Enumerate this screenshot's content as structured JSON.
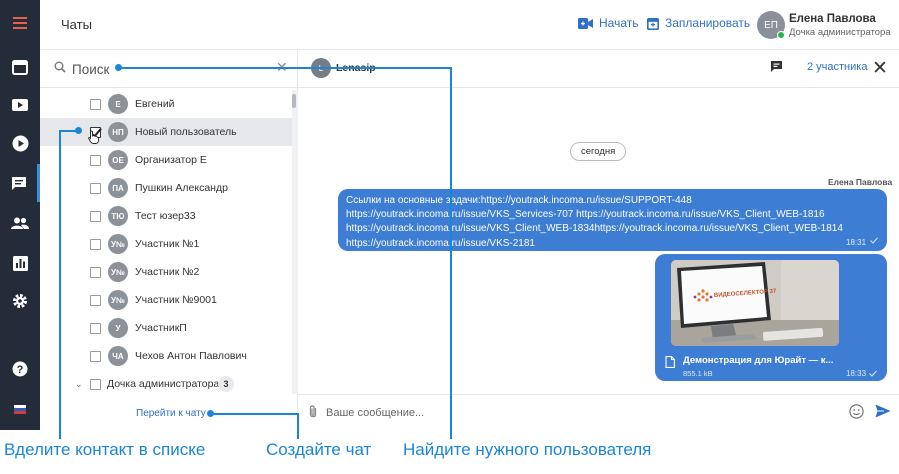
{
  "header": {
    "title": "Чаты",
    "start_label": "Начать",
    "schedule_label": "Запланировать",
    "user": {
      "initials": "ЕП",
      "name": "Елена Павлова",
      "role": "Дочка администратора"
    }
  },
  "sidebar": {
    "items": [
      {
        "icon": "menu-icon"
      },
      {
        "icon": "calendar-icon"
      },
      {
        "icon": "video-camera-icon"
      },
      {
        "icon": "play-icon"
      },
      {
        "icon": "chat-icon",
        "active": true
      },
      {
        "icon": "people-icon"
      },
      {
        "icon": "chart-icon"
      },
      {
        "icon": "gear-icon"
      },
      {
        "icon": "help-icon"
      },
      {
        "icon": "language-flag-icon"
      }
    ]
  },
  "contacts": {
    "search": {
      "placeholder": "Поиск",
      "value": ""
    },
    "items": [
      {
        "initials": "Е",
        "name": "Евгений",
        "checked": false
      },
      {
        "initials": "НП",
        "name": "Новый пользователь",
        "checked": true,
        "selected": true
      },
      {
        "initials": "ОЕ",
        "name": "Организатор Е",
        "checked": false
      },
      {
        "initials": "ПА",
        "name": "Пушкин Александр",
        "checked": false
      },
      {
        "initials": "ТЮ",
        "name": "Тест юзер33",
        "checked": false
      },
      {
        "initials": "У№",
        "name": "Участник №1",
        "checked": false
      },
      {
        "initials": "У№",
        "name": "Участник №2",
        "checked": false
      },
      {
        "initials": "У№",
        "name": "Участник №9001",
        "checked": false
      },
      {
        "initials": "У",
        "name": "УчастникП",
        "checked": false
      },
      {
        "initials": "ЧА",
        "name": "Чехов Антон Павлович",
        "checked": false
      }
    ],
    "group": {
      "name": "Дочка администратора",
      "count": "3"
    },
    "goto_chat_label": "Перейти к чату"
  },
  "chat": {
    "avatar_initial": "L",
    "title": "Lenasip",
    "participants_label": "2 участника",
    "day_label": "сегодня",
    "sender": "Елена Павлова",
    "message": {
      "text": "Ссылки на основные задачи:https://youtrack.incoma.ru/issue/SUPPORT-448 https://youtrack.incoma.ru/issue/VKS_Services-707 https://youtrack.incoma.ru/issue/VKS_Client_WEB-1816 https://youtrack.incoma.ru/issue/VKS_Client_WEB-1834https://youtrack.incoma.ru/issue/VKS_Client_WEB-1814 https://youtrack.incoma.ru/issue/VKS-2181",
      "time": "18:31"
    },
    "attachment": {
      "brand": "ВИДЕОСЕЛЕКТОР 37",
      "file_name": "Демонстрация для Юрайт — к...",
      "file_size": "855.1 kB",
      "time": "18:33"
    },
    "composer": {
      "placeholder": "Ваше сообщение..."
    }
  },
  "callouts": {
    "select_contact": "Вделите контакт в списке",
    "create_chat": "Создайте чат",
    "find_user": "Найдите нужного пользователя"
  },
  "colors": {
    "accent": "#2f6fc4",
    "bubble": "#3d7dd3",
    "rail": "#242c3a",
    "callout": "#1b86d8",
    "rail_menu": "#e8604c"
  }
}
